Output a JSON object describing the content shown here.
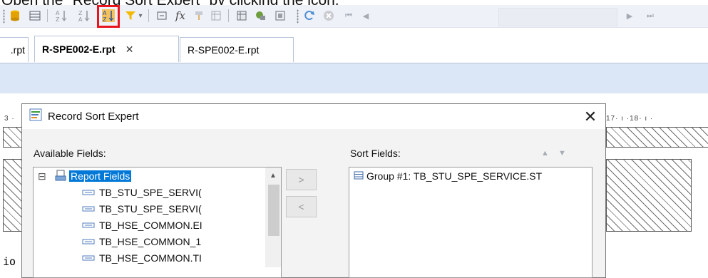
{
  "caption": "Open the \"Record Sort Expert\" by clicking the icon.",
  "tabs": [
    {
      "label": ".rpt"
    },
    {
      "label": "R-SPE002-E.rpt",
      "close": "✕"
    },
    {
      "label": "R-SPE002-E.rpt"
    }
  ],
  "ruler": {
    "left": "3 ·",
    "right": "17· ı ·18· ı ·"
  },
  "dialog": {
    "title": "Record Sort Expert",
    "close": "✕",
    "available_label": "Available Fields:",
    "sort_label": "Sort Fields:",
    "tree_root": "Report Fields",
    "tree_expander": "⊟",
    "fields": [
      "TB_STU_SPE_SERVI(",
      "TB_STU_SPE_SERVI(",
      "TB_HSE_COMMON.EI",
      "TB_HSE_COMMON_1",
      "TB_HSE_COMMON.TI"
    ],
    "add_button": ">",
    "remove_button": "<",
    "sort_items": [
      "Group #1: TB_STU_SPE_SERVICE.ST"
    ]
  },
  "bottom_left_text": "io",
  "colors": {
    "highlight": "#e8141c",
    "selected": "#0078d7",
    "ribbon": "#dbe7f7"
  }
}
